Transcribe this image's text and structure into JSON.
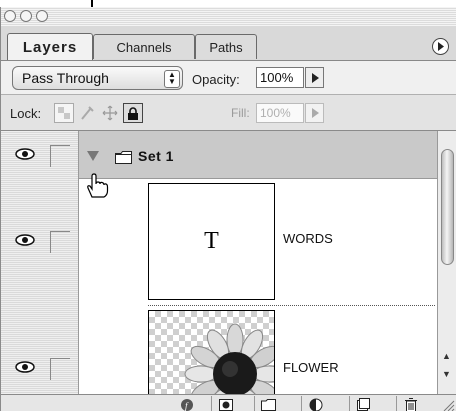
{
  "tabs": [
    "Layers",
    "Channels",
    "Paths"
  ],
  "blend": {
    "mode": "Pass Through"
  },
  "opacity": {
    "label": "Opacity:",
    "value": "100%"
  },
  "lock": {
    "label": "Lock:"
  },
  "fill": {
    "label": "Fill:",
    "value": "100%"
  },
  "set": {
    "name": "Set 1"
  },
  "layers": [
    {
      "name": "WORDS",
      "thumb_text": "T"
    },
    {
      "name": "FLOWER"
    }
  ],
  "colors": {
    "panel": "#e9e9e9",
    "set_row": "#c9c9c9",
    "flower_center": "#1a1a1a"
  },
  "icons": [
    "eye-icon",
    "folder-icon",
    "hand-cursor-icon",
    "palette-menu-icon",
    "trash-icon"
  ]
}
